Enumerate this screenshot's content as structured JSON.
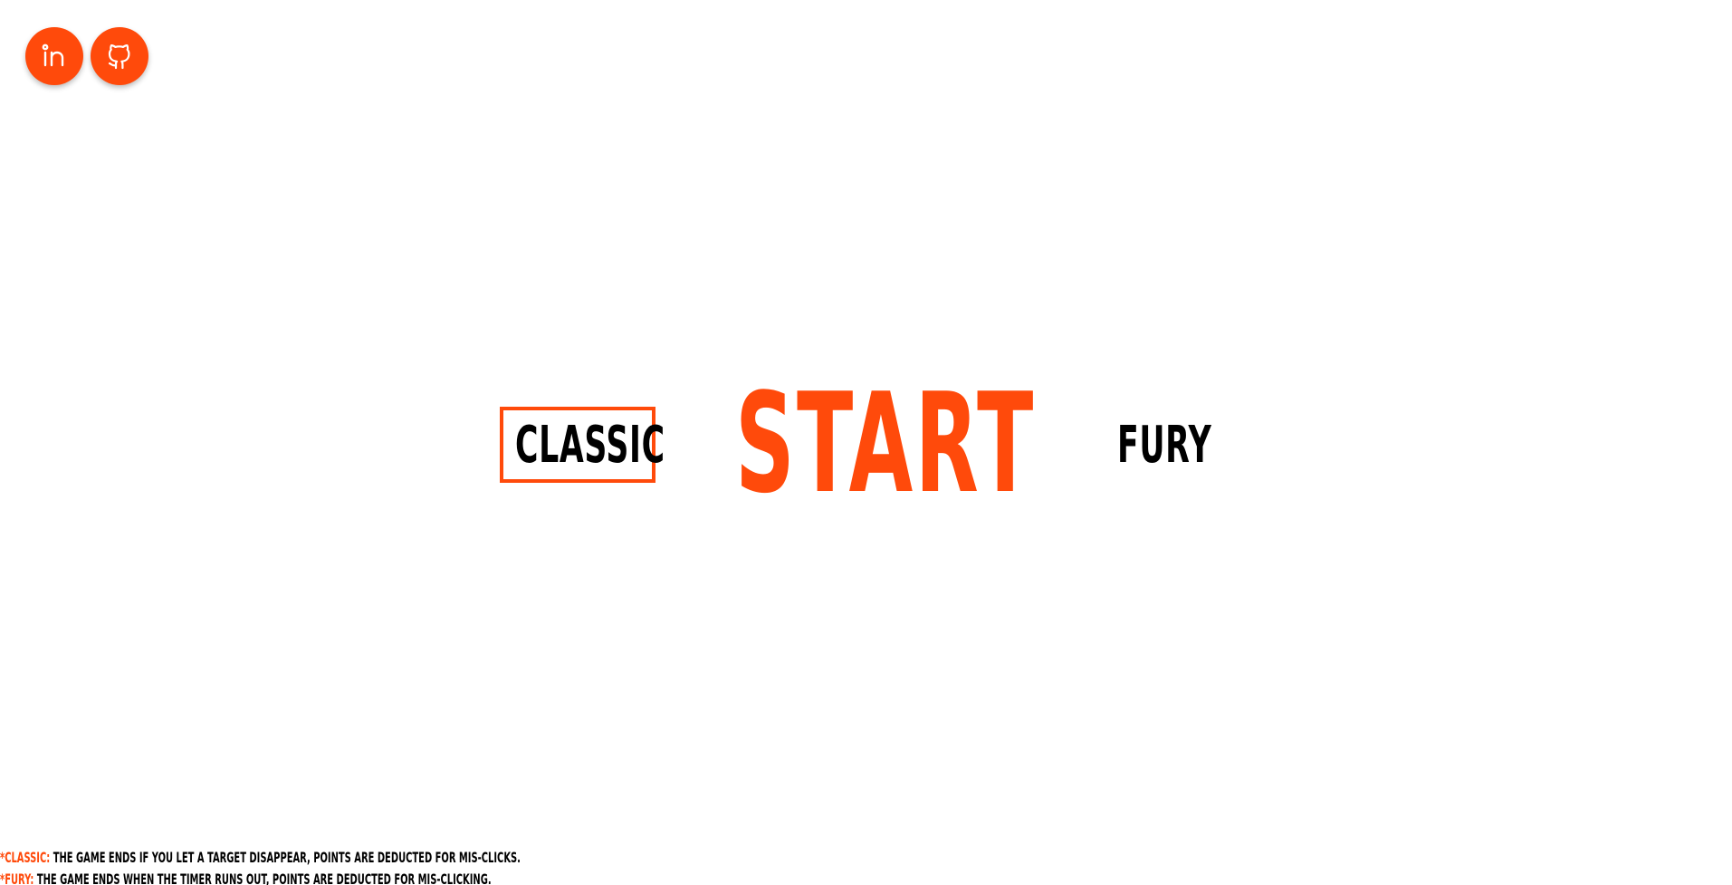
{
  "colors": {
    "accent": "#ff4a0b",
    "text": "#000000",
    "background": "#ffffff"
  },
  "social": {
    "linkedin_icon": "linkedin-icon",
    "github_icon": "github-icon"
  },
  "modes": {
    "classic_label": "CLASSIC",
    "start_label": "START",
    "fury_label": "FURY",
    "selected": "CLASSIC"
  },
  "notes": {
    "classic_tag": "*CLASSIC:",
    "classic_text": " THE GAME ENDS IF YOU LET A TARGET DISAPPEAR, POINTS ARE DEDUCTED FOR MIS-CLICKS.",
    "fury_tag": "*FURY:",
    "fury_text": " THE GAME ENDS WHEN THE TIMER RUNS OUT, POINTS ARE DEDUCTED FOR MIS-CLICKING."
  }
}
